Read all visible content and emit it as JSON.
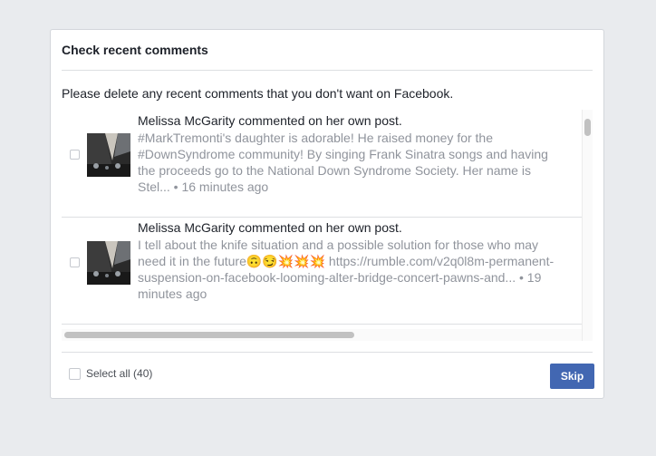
{
  "dialog": {
    "title": "Check recent comments",
    "intro": "Please delete any recent comments that you don't want on Facebook.",
    "items": [
      {
        "author_line": "Melissa McGarity commented on her own post.",
        "line1": "#MarkTremonti's daughter is adorable! He raised money for the",
        "line2": "#DownSyndrome community! By singing Frank Sinatra songs and having",
        "line3": "the proceeds go to the National Down Syndrome Society. Her name is",
        "line4": "Stel... • 16 minutes ago",
        "thumbnail": "concert-photo"
      },
      {
        "author_line": "Melissa McGarity commented on her own post.",
        "line1": "I tell about the knife situation and a possible solution for those who may",
        "line2": "need it in the future🙃😏💥💥💥 https://rumble.com/v2q0l8m-permanent-",
        "line3": "suspension-on-facebook-looming-alter-bridge-concert-pawns-and... • 19",
        "line4": "minutes ago",
        "thumbnail": "concert-photo"
      }
    ],
    "select_all_label": "Select all (40)",
    "skip_label": "Skip"
  },
  "colors": {
    "accent": "#4267b2",
    "page_bg": "#e9ebee",
    "muted_text": "#90949c"
  }
}
